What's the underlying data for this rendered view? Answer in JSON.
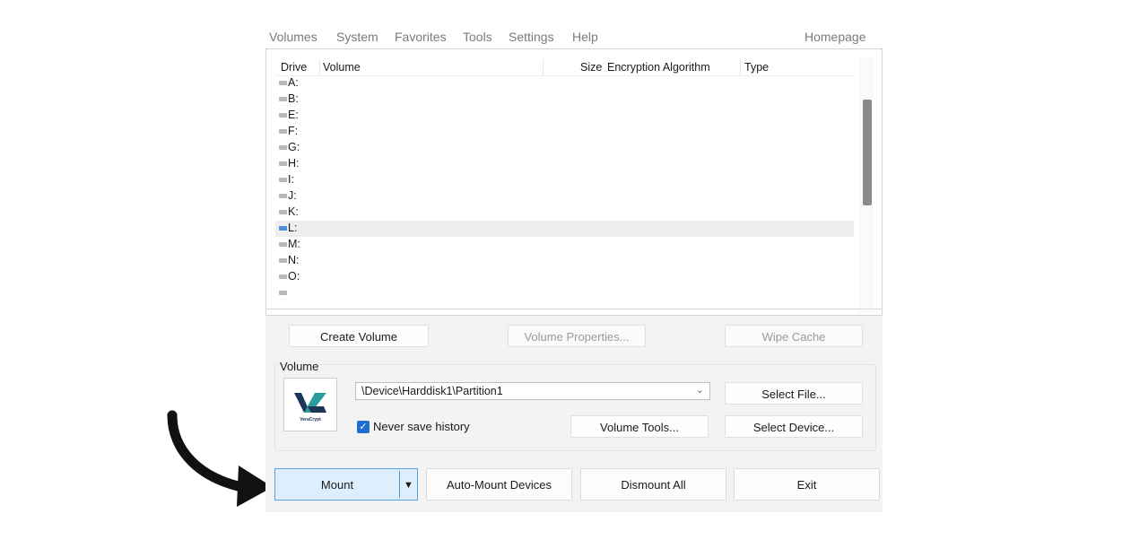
{
  "menu": {
    "items": [
      "Volumes",
      "System",
      "Favorites",
      "Tools",
      "Settings",
      "Help"
    ],
    "homepage": "Homepage"
  },
  "list": {
    "columns": {
      "drive": "Drive",
      "volume": "Volume",
      "size": "Size",
      "encryption": "Encryption Algorithm",
      "type": "Type"
    },
    "drives": [
      "A:",
      "B:",
      "E:",
      "F:",
      "G:",
      "H:",
      "I:",
      "J:",
      "K:",
      "L:",
      "M:",
      "N:",
      "O:"
    ],
    "selected_drive": "L:"
  },
  "buttons": {
    "create_volume": "Create Volume",
    "volume_properties": "Volume Properties...",
    "wipe_cache": "Wipe Cache",
    "select_file": "Select File...",
    "volume_tools": "Volume Tools...",
    "select_device": "Select Device...",
    "mount": "Mount",
    "auto_mount": "Auto-Mount Devices",
    "dismount_all": "Dismount All",
    "exit": "Exit"
  },
  "volume_group": {
    "label": "Volume",
    "path": "\\Device\\Harddisk1\\Partition1",
    "never_save_history_label": "Never save history",
    "never_save_history_checked": true,
    "logo_text": "VeraCrypt"
  },
  "colors": {
    "accent": "#1f6fcf",
    "logo_teal": "#2a9d9d",
    "logo_navy": "#1d3557",
    "mount_bg": "#ddeefc"
  },
  "icons": {
    "drive": "drive-icon",
    "dropdown": "chevron-down-icon",
    "check": "checkmark-icon",
    "split_caret": "caret-down-icon",
    "annotation": "curved-arrow-icon"
  }
}
